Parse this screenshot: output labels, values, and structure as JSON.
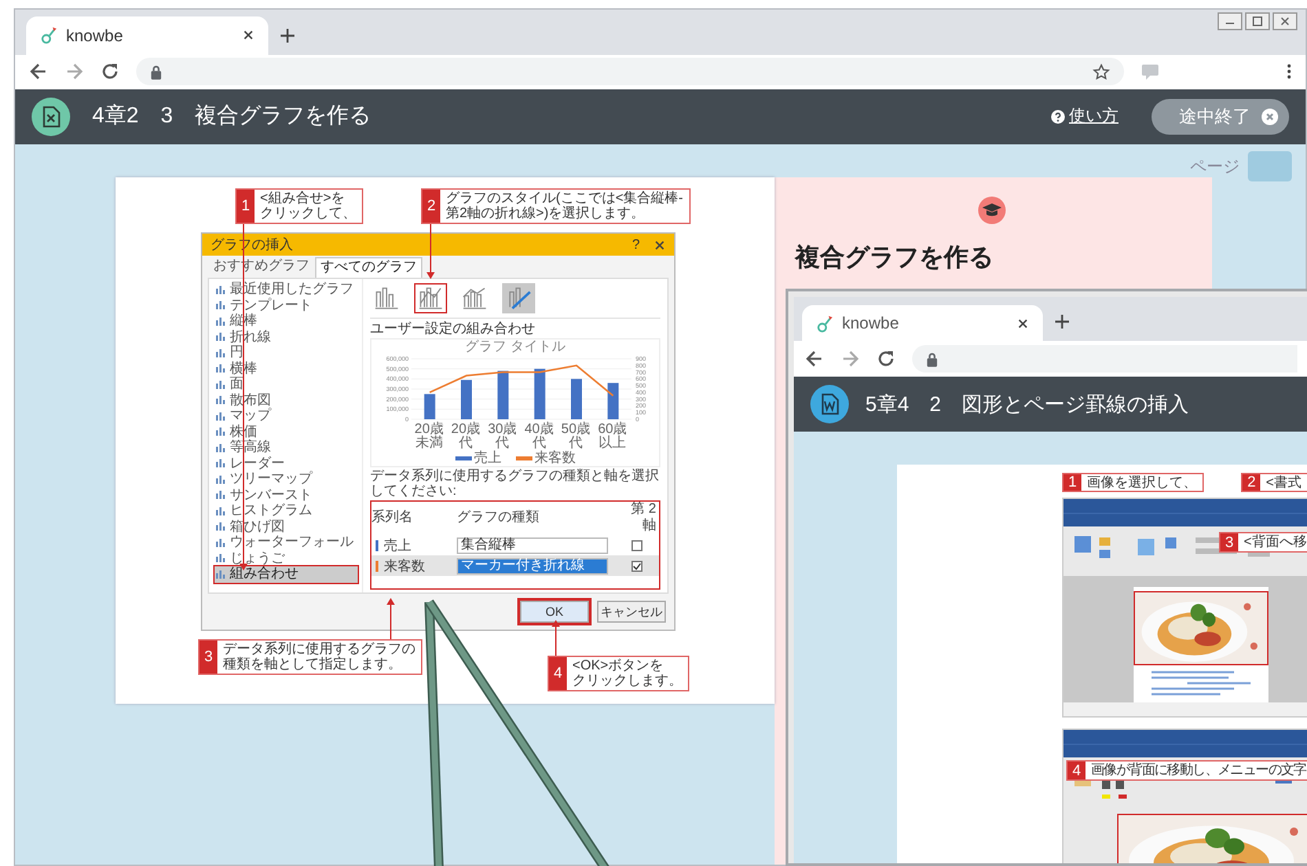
{
  "browser": {
    "tab_title": "knowbe"
  },
  "header": {
    "title": "4章2　3　複合グラフを作る",
    "help_link": "使い方",
    "quit_button": "途中終了"
  },
  "pager": {
    "label": "ページ"
  },
  "tutorial": {
    "dialog": {
      "title": "グラフの挿入",
      "help": "?",
      "tabs": [
        {
          "label": "おすすめグラフ",
          "selected": false
        },
        {
          "label": "すべてのグラフ",
          "selected": true
        }
      ],
      "chart_types": [
        {
          "label": "最近使用したグラフ",
          "selected": false
        },
        {
          "label": "テンプレート",
          "selected": false
        },
        {
          "label": "縦棒",
          "selected": false
        },
        {
          "label": "折れ線",
          "selected": false
        },
        {
          "label": "円",
          "selected": false
        },
        {
          "label": "横棒",
          "selected": false
        },
        {
          "label": "面",
          "selected": false
        },
        {
          "label": "散布図",
          "selected": false
        },
        {
          "label": "マップ",
          "selected": false
        },
        {
          "label": "株価",
          "selected": false
        },
        {
          "label": "等高線",
          "selected": false
        },
        {
          "label": "レーダー",
          "selected": false
        },
        {
          "label": "ツリーマップ",
          "selected": false
        },
        {
          "label": "サンバースト",
          "selected": false
        },
        {
          "label": "ヒストグラム",
          "selected": false
        },
        {
          "label": "箱ひげ図",
          "selected": false
        },
        {
          "label": "ウォーターフォール",
          "selected": false
        },
        {
          "label": "じょうご",
          "selected": false
        },
        {
          "label": "組み合わせ",
          "selected": true
        }
      ],
      "styles": [
        {
          "selected": false,
          "highlighted": false
        },
        {
          "selected": false,
          "highlighted": true
        },
        {
          "selected": false,
          "highlighted": false
        },
        {
          "selected": true,
          "highlighted": false
        }
      ],
      "combo_title": "ユーザー設定の組み合わせ",
      "chart_data": {
        "type": "bar",
        "title": "グラフ タイトル",
        "categories": [
          "20歳未満",
          "20歳代",
          "30歳代",
          "40歳代",
          "50歳代",
          "60歳以上"
        ],
        "series": [
          {
            "name": "売上",
            "color": "#4472c4",
            "type": "bar",
            "values": [
              250000,
              390000,
              480000,
              500000,
              400000,
              360000
            ]
          },
          {
            "name": "来客数",
            "color": "#ed7d31",
            "type": "line",
            "axis": "y2",
            "values": [
              400,
              650,
              700,
              700,
              800,
              350
            ]
          }
        ],
        "ylim": [
          0,
          600000
        ],
        "y2lim": [
          0,
          900
        ],
        "grid": true,
        "legend": "bottom",
        "yticks": [
          {
            "value": 0,
            "label": "0"
          },
          {
            "value": 100000,
            "label": "100,000"
          },
          {
            "value": 200000,
            "label": "200,000"
          },
          {
            "value": 300000,
            "label": "300,000"
          },
          {
            "value": 400000,
            "label": "400,000"
          },
          {
            "value": 500000,
            "label": "500,000"
          },
          {
            "value": 600000,
            "label": "600,000"
          }
        ],
        "y2ticks": [
          0,
          100,
          200,
          300,
          400,
          500,
          600,
          700,
          800,
          900
        ]
      },
      "series_prompt": "データ系列に使用するグラフの種類と軸を選択してください:",
      "series_columns": [
        "系列名",
        "グラフの種類",
        "第 2 軸"
      ],
      "series": [
        {
          "name": "売上",
          "color": "#4472c4",
          "chart_type": "集合縦棒",
          "secondary_axis": false,
          "selected": false
        },
        {
          "name": "来客数",
          "color": "#ed7d31",
          "chart_type": "マーカー付き折れ線",
          "secondary_axis": true,
          "selected": true
        }
      ],
      "buttons": [
        {
          "label": "OK",
          "highlighted": true
        },
        {
          "label": "キャンセル",
          "highlighted": false
        }
      ]
    },
    "callouts": [
      {
        "number": "1",
        "lines": [
          "<組み合せ>を",
          "クリックして、"
        ]
      },
      {
        "number": "2",
        "lines": [
          "グラフのスタイル(ここでは<集合縦棒-",
          "第2軸の折れ線>)を選択します。"
        ]
      },
      {
        "number": "3",
        "lines": [
          "データ系列に使用するグラフの",
          "種類を軸として指定します。"
        ]
      },
      {
        "number": "4",
        "lines": [
          "<OK>ボタンを",
          "クリックします。"
        ]
      }
    ]
  },
  "side_panel": {
    "title": "複合グラフを作る"
  },
  "preview": {
    "tab_title": "knowbe",
    "header_title": "5章4　2　図形とページ罫線の挿入",
    "callouts": [
      {
        "number": "1",
        "lines": [
          "画像を選択して、"
        ]
      },
      {
        "number": "2",
        "lines": [
          "<書式"
        ]
      },
      {
        "number": "3",
        "lines": [
          "<背面へ移"
        ]
      },
      {
        "number": "4",
        "lines": [
          "画像が背面に移動し、メニューの文字"
        ]
      }
    ]
  }
}
